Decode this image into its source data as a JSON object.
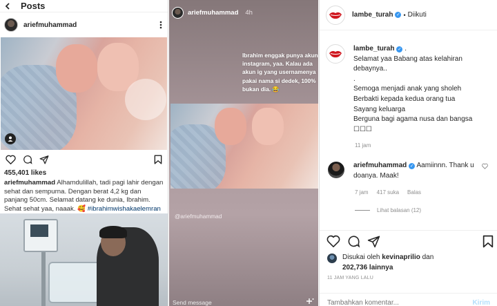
{
  "mobile_post": {
    "header_title": "Posts",
    "username": "ariefmuhammad",
    "likes": "455,401 likes",
    "caption_user": "ariefmuhammad",
    "caption_text": " Alhamdulillah, tadi pagi lahir dengan sehat dan sempurna. Dengan berat 4,2 kg dan panjang 50cm. Selamat datang ke dunia, Ibrahim. Sehat sehat yaa, naaak. 🥰 ",
    "caption_tag": "#ibrahimwishakaelemran"
  },
  "story": {
    "username": "ariefmuhammad",
    "time": "4h",
    "text": "Ibrahim enggak punya akun instagram, yaa. Kalau ada akun ig yang usernamenya pakai nama si dedek, 100% bukan dia. 😂",
    "mention": "@ariefmuhammad",
    "send_placeholder": "Send message"
  },
  "desktop_post": {
    "account": "lambe_turah",
    "dot": "•",
    "follow_status": "Diikuti",
    "post_user": "lambe_turah",
    "post_user_suffix": " .",
    "post_lines": [
      "Selamat yaa Babang atas kelahiran",
      "debaynya..",
      ".",
      "Semoga menjadi anak yang sholeh",
      "Berbakti kepada kedua orang tua",
      "Sayang keluarga",
      "Berguna bagi agama nusa dan bangsa",
      "☐☐☐"
    ],
    "post_time": "11 jam",
    "comment_user": "ariefmuhammad",
    "comment_text": " Aamiinnn. Thank u doanya. Maak!",
    "comment_time": "7 jam",
    "comment_likes": "417 suka",
    "reply_label": "Balas",
    "view_replies": "Lihat balasan (12)",
    "liked_by_prefix": "Disukai oleh ",
    "liked_by_user": "kevinaprilio",
    "liked_by_mid": " dan",
    "liked_by_count": "202,736",
    "liked_by_suffix": " lainnya",
    "date": "11 JAM YANG LALU",
    "comment_placeholder": "Tambahkan komentar...",
    "post_button": "Kirim"
  },
  "colors": {
    "verified": "#3897f0",
    "link": "#00376b",
    "muted": "#8e8e8e",
    "post_button": "#b2dffc",
    "lips": "#d0171f"
  }
}
